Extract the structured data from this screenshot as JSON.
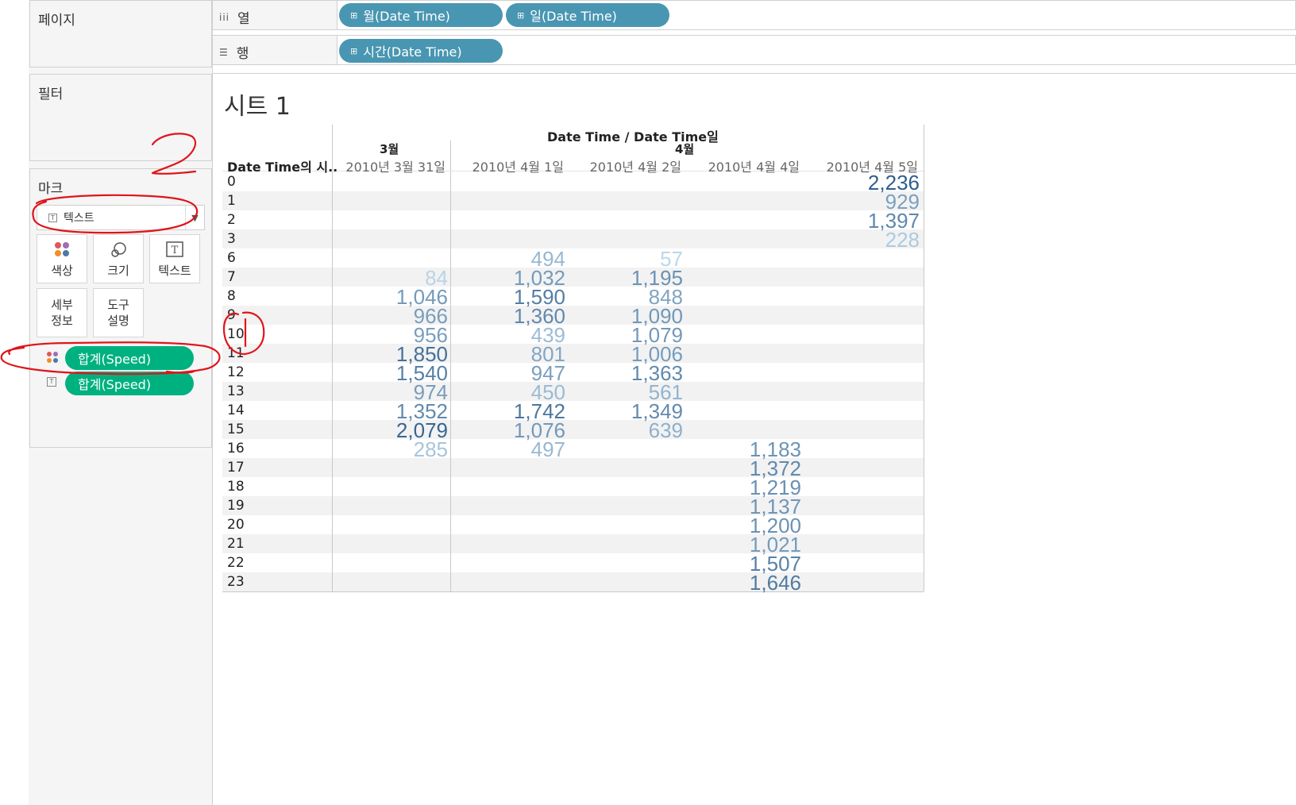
{
  "shelves": {
    "pages_title": "페이지",
    "filters_title": "필터",
    "columns_label": "열",
    "columns_icon": "iii",
    "rows_label": "행",
    "rows_icon": "rows-icon",
    "column_pills": [
      "월(Date Time)",
      "일(Date Time)"
    ],
    "row_pills": [
      "시간(Date Time)"
    ],
    "pill_icon": "⊞"
  },
  "marks": {
    "title": "마크",
    "mark_type": "텍스트",
    "buttons": {
      "color": "색상",
      "size": "크기",
      "text": "텍스트",
      "detail": [
        "세부",
        "정보"
      ],
      "tooltip": [
        "도구",
        "설명"
      ]
    },
    "fields": [
      "합계(Speed)",
      "합계(Speed)"
    ]
  },
  "sheet": {
    "title": "시트 1",
    "header_top": "Date Time / Date Time일",
    "row_header": "Date Time의 시..",
    "months": [
      "3월",
      "4월"
    ],
    "columns": [
      "2010년 3월 31일",
      "2010년 4월 1일",
      "2010년 4월 2일",
      "2010년 4월 4일",
      "2010년 4월 5일"
    ],
    "rows": [
      {
        "hour": "0",
        "cells": [
          "",
          "",
          "",
          "",
          "2,236"
        ]
      },
      {
        "hour": "1",
        "cells": [
          "",
          "",
          "",
          "",
          "929"
        ]
      },
      {
        "hour": "2",
        "cells": [
          "",
          "",
          "",
          "",
          "1,397"
        ]
      },
      {
        "hour": "3",
        "cells": [
          "",
          "",
          "",
          "",
          "228"
        ]
      },
      {
        "hour": "6",
        "cells": [
          "",
          "494",
          "57",
          "",
          ""
        ]
      },
      {
        "hour": "7",
        "cells": [
          "84",
          "1,032",
          "1,195",
          "",
          ""
        ]
      },
      {
        "hour": "8",
        "cells": [
          "1,046",
          "1,590",
          "848",
          "",
          ""
        ]
      },
      {
        "hour": "9",
        "cells": [
          "966",
          "1,360",
          "1,090",
          "",
          ""
        ]
      },
      {
        "hour": "10",
        "cells": [
          "956",
          "439",
          "1,079",
          "",
          ""
        ]
      },
      {
        "hour": "11",
        "cells": [
          "1,850",
          "801",
          "1,006",
          "",
          ""
        ]
      },
      {
        "hour": "12",
        "cells": [
          "1,540",
          "947",
          "1,363",
          "",
          ""
        ]
      },
      {
        "hour": "13",
        "cells": [
          "974",
          "450",
          "561",
          "",
          ""
        ]
      },
      {
        "hour": "14",
        "cells": [
          "1,352",
          "1,742",
          "1,349",
          "",
          ""
        ]
      },
      {
        "hour": "15",
        "cells": [
          "2,079",
          "1,076",
          "639",
          "",
          ""
        ]
      },
      {
        "hour": "16",
        "cells": [
          "285",
          "497",
          "",
          "1,183",
          ""
        ]
      },
      {
        "hour": "17",
        "cells": [
          "",
          "",
          "",
          "1,372",
          ""
        ]
      },
      {
        "hour": "18",
        "cells": [
          "",
          "",
          "",
          "1,219",
          ""
        ]
      },
      {
        "hour": "19",
        "cells": [
          "",
          "",
          "",
          "1,137",
          ""
        ]
      },
      {
        "hour": "20",
        "cells": [
          "",
          "",
          "",
          "1,200",
          ""
        ]
      },
      {
        "hour": "21",
        "cells": [
          "",
          "",
          "",
          "1,021",
          ""
        ]
      },
      {
        "hour": "22",
        "cells": [
          "",
          "",
          "",
          "1,507",
          ""
        ]
      },
      {
        "hour": "23",
        "cells": [
          "",
          "",
          "",
          "1,646",
          ""
        ]
      }
    ],
    "color_scale": {
      "min_value": 57,
      "max_value": 2236,
      "light": "#bcd7ea",
      "dark": "#2f5f8c"
    }
  },
  "annotations": {
    "ink_color": "#e0141a",
    "number_label": "2"
  }
}
